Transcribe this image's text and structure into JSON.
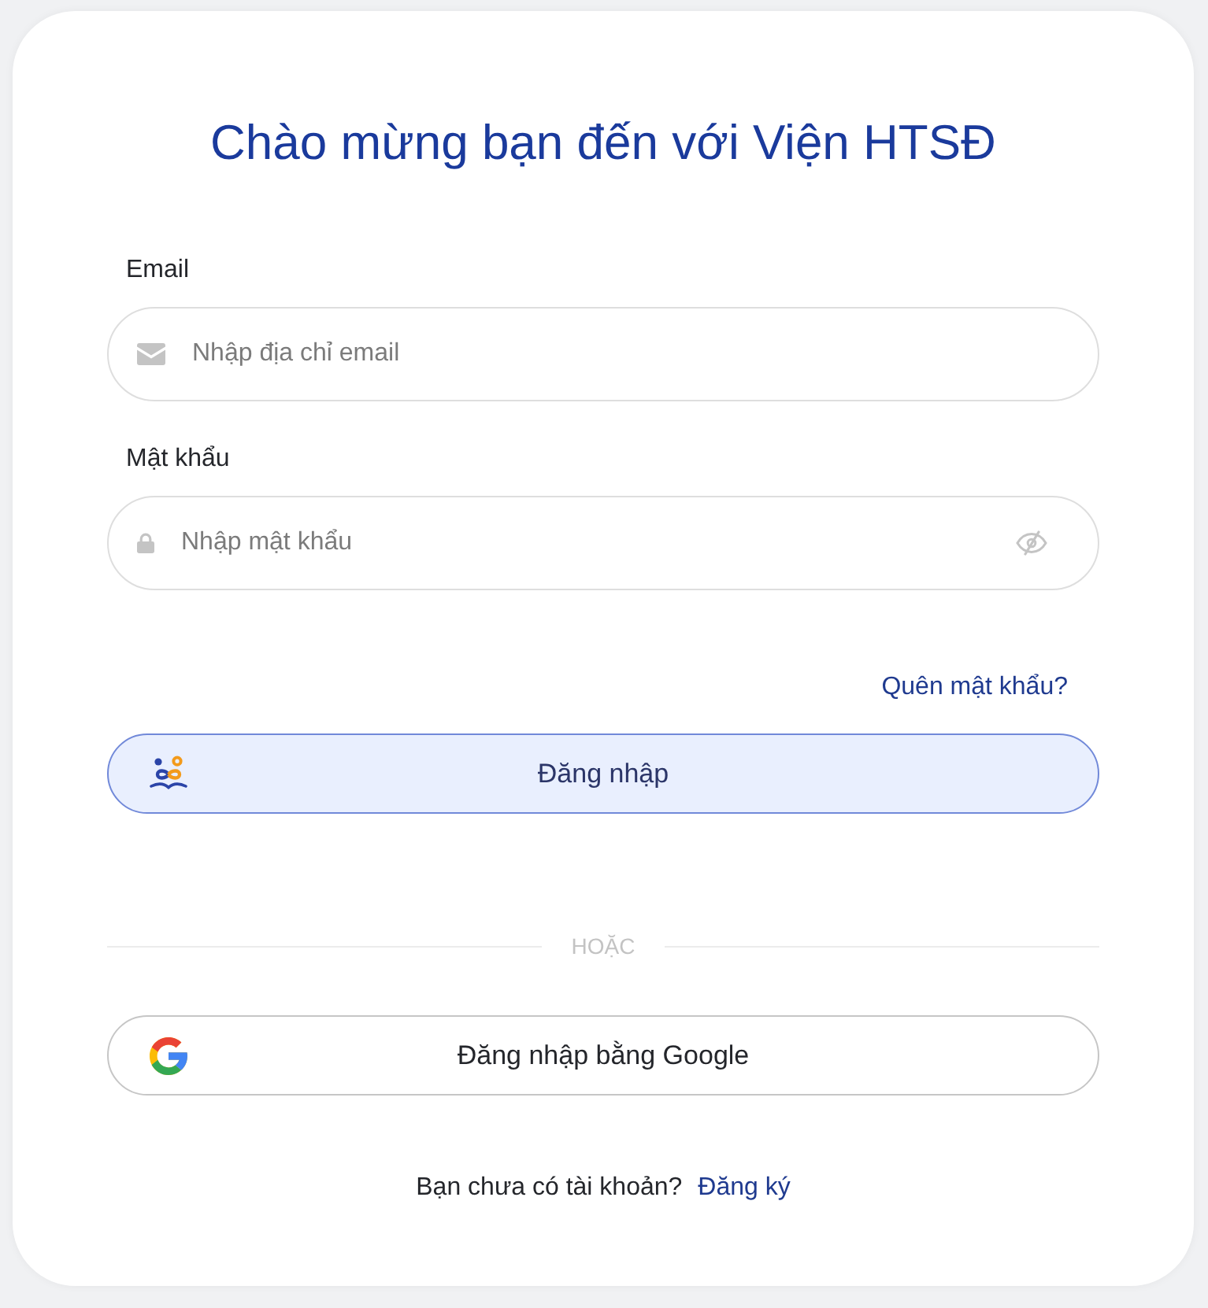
{
  "title": "Chào mừng bạn đến với Viện HTSĐ",
  "fields": [
    {
      "kind": "email",
      "label": "Email",
      "placeholder": "Nhập địa chỉ email"
    },
    {
      "kind": "password",
      "label": "Mật khẩu",
      "placeholder": "Nhập mật khẩu",
      "visible": false
    }
  ],
  "forgot_password": "Quên mật khẩu?",
  "buttons": [
    {
      "kind": "login",
      "label": "Đăng nhập"
    }
  ],
  "divider": "HOẶC",
  "social_buttons": [
    {
      "kind": "google",
      "label": "Đăng nhập bằng Google"
    }
  ],
  "signup": {
    "prompt": "Bạn chưa có tài khoản?",
    "link": "Đăng ký"
  }
}
